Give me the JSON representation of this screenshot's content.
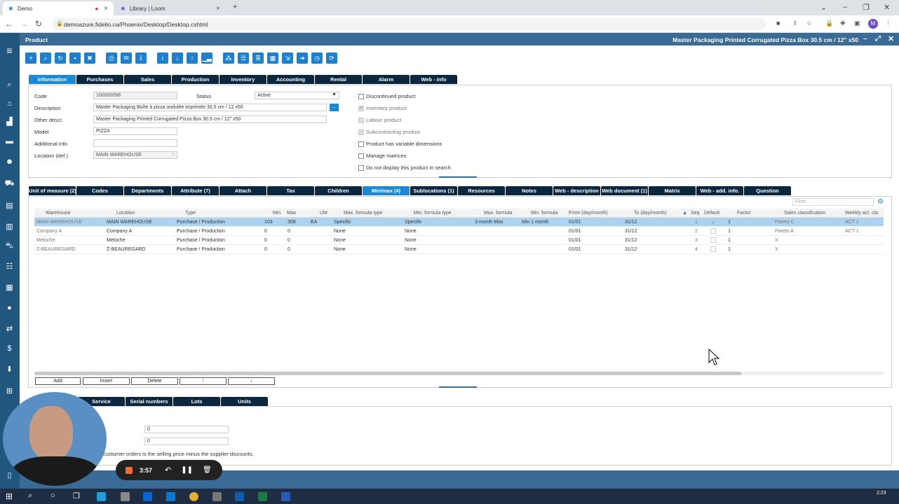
{
  "browser": {
    "tabs": [
      {
        "title": "Demo"
      },
      {
        "title": "Library | Loom"
      }
    ],
    "url": "demoazure.fidelio.ca/Phoenix/Desktop/Desktop.cshtml",
    "profile_initial": "M"
  },
  "app": {
    "title": "Product",
    "product_title": "Master Packaging Printed Corrugated Pizza Box 30.5 cm / 12\" x50"
  },
  "top_tabs": [
    "Information",
    "Purchases",
    "Sales",
    "Production",
    "Inventory",
    "Accounting",
    "Rental",
    "Alarm",
    "Web - info"
  ],
  "form": {
    "code_label": "Code",
    "code_value": "100000098",
    "status_label": "Status",
    "status_value": "Active",
    "description_label": "Description",
    "description_value": "Master Packaging Boîte à pizza ondulée imprimée 30,5 cm / 12 x50",
    "other_label": "Other descr.",
    "other_value": "Master Packaging Printed Corrugated Pizza Box 30.5 cm / 12\" x50",
    "model_label": "Model",
    "model_value": "PIZZA",
    "addinfo_label": "Additional info",
    "addinfo_value": "",
    "location_label": "Location (def.)",
    "location_value": "MAIN WAREHOUSE",
    "ellipsis": "..."
  },
  "checkboxes": [
    {
      "label": "Discontinued product",
      "checked": false
    },
    {
      "label": "Inventory product",
      "checked": true
    },
    {
      "label": "Labour product",
      "checked": false
    },
    {
      "label": "Subcontracting product",
      "checked": false
    },
    {
      "label": "Product has variable dimensions",
      "checked": false
    },
    {
      "label": "Manage matrices",
      "checked": false
    },
    {
      "label": "Do not display this product in search",
      "checked": false
    }
  ],
  "sub_tabs": [
    "Unit of measure (2)",
    "Codes",
    "Departments",
    "Attribute (7)",
    "Attach",
    "Tax",
    "Children",
    "Min/max (4)",
    "Sublocations (1)",
    "Resources",
    "Notes",
    "Web - description",
    "Web document (1)",
    "Matrix",
    "Web - add. info.",
    "Question"
  ],
  "grid": {
    "filter_placeholder": "Filter",
    "columns": [
      "Warehouse",
      "Location",
      "Type",
      "Min",
      "Max",
      "UM",
      "Max. formula type",
      "Min. formula type",
      "Max. formula",
      "Min. formula",
      "From (day/month)",
      "To (day/month)",
      "Seq",
      "Default",
      "Factor",
      "Sales classification",
      "Weekly act. cla"
    ],
    "rows": [
      [
        "MAIN WAREHOUSE",
        "MAIN WAREHOUSE",
        "Purchase / Production",
        "103",
        "308",
        "EA",
        "Specific",
        "Specific",
        "3 month Max",
        "Min 1 month",
        "01/01",
        "31/12",
        "1",
        "✓",
        "1",
        "Pareto C",
        "ACT 1"
      ],
      [
        "Company A",
        "Company A",
        "Purchase / Production",
        "0",
        "0",
        "",
        "None",
        "None",
        "",
        "",
        "01/01",
        "31/12",
        "2",
        "",
        "1",
        "Pareto A",
        "ACT 1"
      ],
      [
        "Meloche",
        "Meloche",
        "Purchase / Production",
        "0",
        "0",
        "",
        "None",
        "None",
        "",
        "",
        "01/01",
        "31/12",
        "3",
        "",
        "1",
        "X",
        ""
      ],
      [
        "Z-BEAUREGARD",
        "Z-BEAUREGARD",
        "Purchase / Production",
        "0",
        "0",
        "",
        "None",
        "None",
        "",
        "",
        "01/01",
        "31/12",
        "4",
        "",
        "1",
        "X",
        ""
      ]
    ]
  },
  "grid_buttons": [
    "Add",
    "Insert",
    "Delete",
    "↑",
    "↓"
  ],
  "bottom_tabs": [
    "Service",
    "Serial numbers",
    "Lots",
    "Units"
  ],
  "bottom": {
    "field1": "0",
    "field2": "0",
    "note": "customer orders is the selling price minus the supplier discounts."
  },
  "loom": {
    "time": "3:57"
  },
  "taskbar": {
    "clock": "2:23"
  }
}
